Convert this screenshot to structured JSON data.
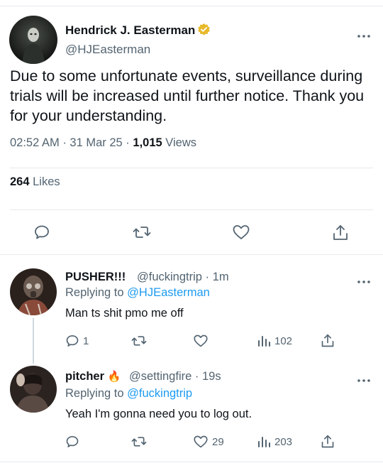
{
  "main_tweet": {
    "author_name": "Hendrick J. Easterman",
    "handle": "@HJEasterman",
    "text": "Due to some unfortunate events, surveillance during trials will be increased until further notice. Thank you for your understanding.",
    "time": "02:52 AM",
    "date": "31 Mar 25",
    "views_count": "1,015",
    "views_label": "Views",
    "likes_count": "264",
    "likes_label": "Likes",
    "separator": "·"
  },
  "replies": [
    {
      "author_name": "PUSHER!!!",
      "handle": "@fuckingtrip",
      "time": "1m",
      "replying_prefix": "Replying to",
      "replying_to": "@HJEasterman",
      "text": "Man ts shit pmo me off",
      "reply_count": "1",
      "retweet_count": "",
      "like_count": "",
      "views_count": "102"
    },
    {
      "author_name": "pitcher",
      "emoji": "🔥",
      "handle": "@settingfire",
      "time": "19s",
      "replying_prefix": "Replying to",
      "replying_to": "@fuckingtrip",
      "text": "Yeah I'm gonna need you to log out.",
      "reply_count": "",
      "retweet_count": "",
      "like_count": "29",
      "views_count": "203"
    }
  ],
  "icons": [
    "verified-badge-icon",
    "more-icon",
    "reply-icon",
    "retweet-icon",
    "like-icon",
    "share-icon",
    "views-icon"
  ],
  "colors": {
    "accent": "#1d9bf0",
    "verified": "#e8b92b",
    "muted": "#536471",
    "text": "#0f1419",
    "divider": "#e6e9ec"
  }
}
